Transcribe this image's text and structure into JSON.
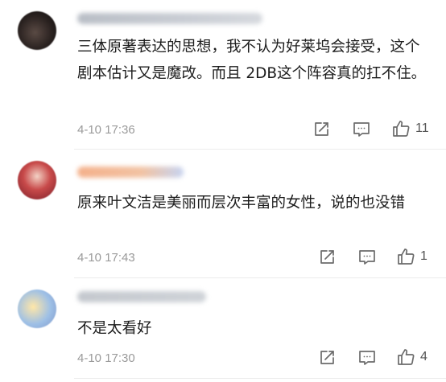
{
  "comments": [
    {
      "text": "三体原著表达的思想，我不认为好莱坞会接受，这个剧本估计又是魔改。而且 2DB这个阵容真的扛不住。",
      "time": "4-10 17:36",
      "likes": "11"
    },
    {
      "text": "原来叶文洁是美丽而层次丰富的女性，说的也没错",
      "time": "4-10 17:43",
      "likes": "1"
    },
    {
      "text": "不是太看好",
      "time": "4-10 17:30",
      "likes": "4"
    }
  ],
  "icons": {
    "forward": "share-icon",
    "reply": "comment-icon",
    "like": "thumbs-up-icon"
  },
  "colors": {
    "icon": "#6b6b6b",
    "meta": "#9a9a9a",
    "text": "#1c1c1c"
  }
}
